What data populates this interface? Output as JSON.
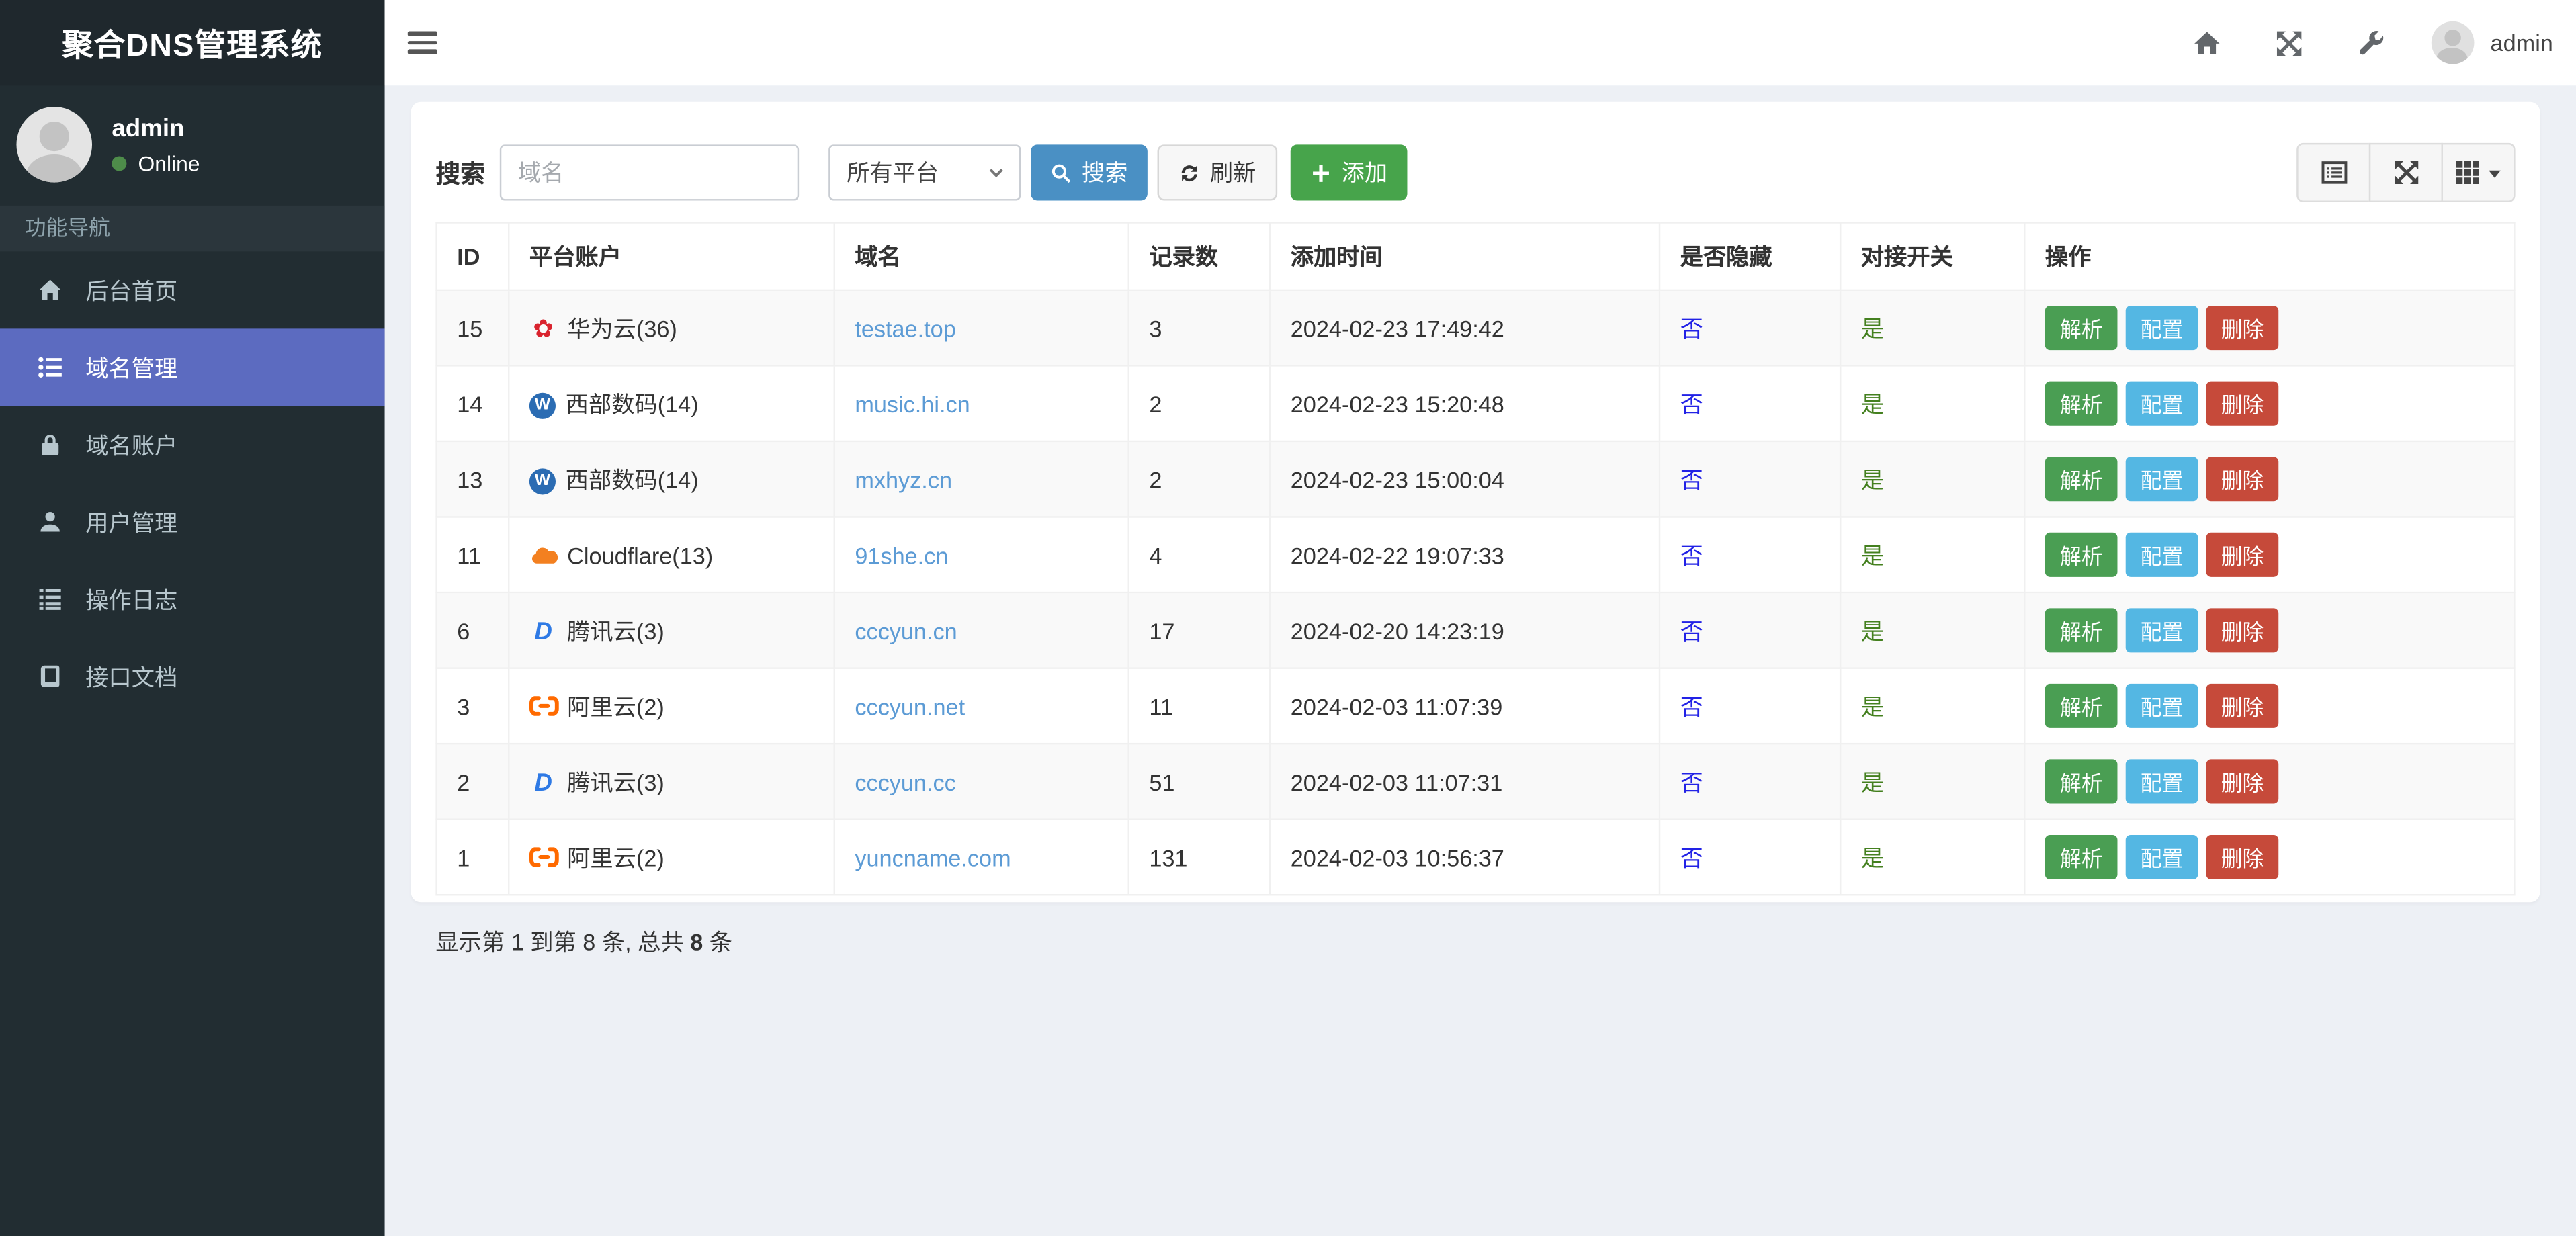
{
  "app": {
    "title": "聚合DNS管理系统"
  },
  "sidebar": {
    "user": {
      "name": "admin",
      "status": "Online"
    },
    "section_label": "功能导航",
    "items": [
      {
        "label": "后台首页",
        "icon": "home-icon",
        "active": false
      },
      {
        "label": "域名管理",
        "icon": "list-icon",
        "active": true
      },
      {
        "label": "域名账户",
        "icon": "lock-icon",
        "active": false
      },
      {
        "label": "用户管理",
        "icon": "user-icon",
        "active": false
      },
      {
        "label": "操作日志",
        "icon": "log-list-icon",
        "active": false
      },
      {
        "label": "接口文档",
        "icon": "book-icon",
        "active": false
      }
    ]
  },
  "navbar": {
    "user_name": "admin",
    "icons": [
      "home-icon",
      "fullscreen-icon",
      "wrench-icon"
    ]
  },
  "toolbar": {
    "search_label": "搜索",
    "search_placeholder": "域名",
    "platform_select_value": "所有平台",
    "search_button": "搜索",
    "refresh_button": "刷新",
    "add_button": "添加",
    "view_buttons": [
      "detail-view-icon",
      "expand-icon",
      "columns-grid-icon"
    ]
  },
  "table": {
    "columns": [
      "ID",
      "平台账户",
      "域名",
      "记录数",
      "添加时间",
      "是否隐藏",
      "对接开关",
      "操作"
    ],
    "action_labels": [
      "解析",
      "配置",
      "删除"
    ],
    "rows": [
      {
        "id": "15",
        "platform_icon": "huawei-cloud-icon",
        "platform": "华为云(36)",
        "domain": "testae.top",
        "records": "3",
        "added": "2024-02-23 17:49:42",
        "hidden": "否",
        "switch": "是"
      },
      {
        "id": "14",
        "platform_icon": "west-digital-icon",
        "platform": "西部数码(14)",
        "domain": "music.hi.cn",
        "records": "2",
        "added": "2024-02-23 15:20:48",
        "hidden": "否",
        "switch": "是"
      },
      {
        "id": "13",
        "platform_icon": "west-digital-icon",
        "platform": "西部数码(14)",
        "domain": "mxhyz.cn",
        "records": "2",
        "added": "2024-02-23 15:00:04",
        "hidden": "否",
        "switch": "是"
      },
      {
        "id": "11",
        "platform_icon": "cloudflare-icon",
        "platform": "Cloudflare(13)",
        "domain": "91she.cn",
        "records": "4",
        "added": "2024-02-22 19:07:33",
        "hidden": "否",
        "switch": "是"
      },
      {
        "id": "6",
        "platform_icon": "tencent-cloud-icon",
        "platform": "腾讯云(3)",
        "domain": "cccyun.cn",
        "records": "17",
        "added": "2024-02-20 14:23:19",
        "hidden": "否",
        "switch": "是"
      },
      {
        "id": "3",
        "platform_icon": "aliyun-icon",
        "platform": "阿里云(2)",
        "domain": "cccyun.net",
        "records": "11",
        "added": "2024-02-03 11:07:39",
        "hidden": "否",
        "switch": "是"
      },
      {
        "id": "2",
        "platform_icon": "tencent-cloud-icon",
        "platform": "腾讯云(3)",
        "domain": "cccyun.cc",
        "records": "51",
        "added": "2024-02-03 11:07:31",
        "hidden": "否",
        "switch": "是"
      },
      {
        "id": "1",
        "platform_icon": "aliyun-icon",
        "platform": "阿里云(2)",
        "domain": "yuncname.com",
        "records": "131",
        "added": "2024-02-03 10:56:37",
        "hidden": "否",
        "switch": "是"
      }
    ],
    "footer": {
      "before": "显示第 1 到第 8 条, 总共 ",
      "bold": "8",
      "after": " 条"
    }
  },
  "colors": {
    "sidebar_bg": "#222d32",
    "active_item": "#5c6bc0",
    "primary_button": "#4a90c4",
    "add_button": "#47a44b",
    "parse_button": "#4a9e53",
    "config_button": "#54b7e3",
    "delete_button": "#c64a3a",
    "domain_link": "#5c9bd5",
    "hidden_flag": "#2222e6",
    "switch_flag": "#44801f",
    "content_bg": "#edf0f5"
  }
}
